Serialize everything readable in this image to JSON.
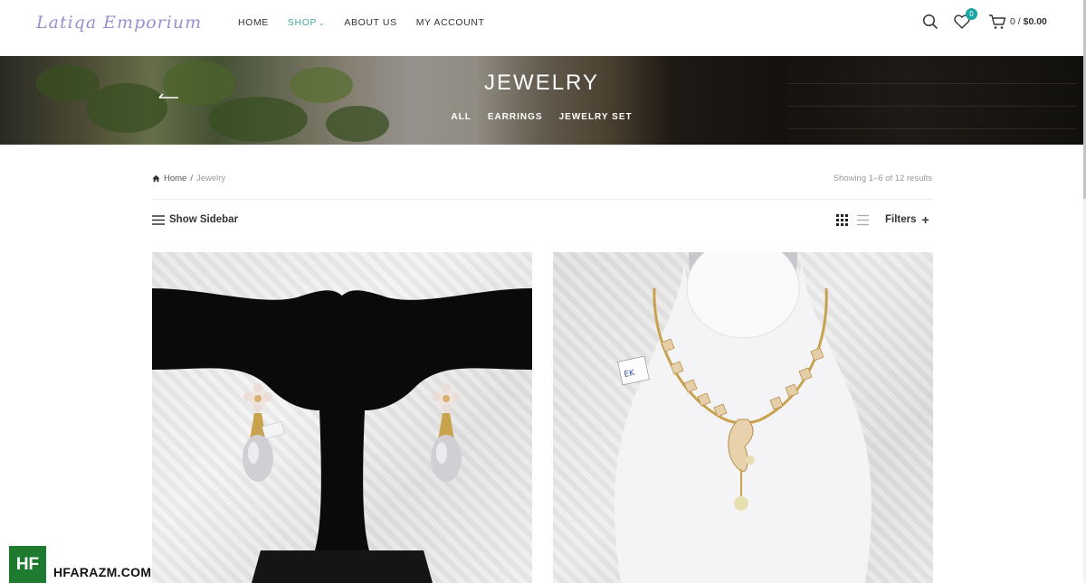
{
  "brand": {
    "logo_text": "Latiqa Emporium"
  },
  "nav": {
    "items": [
      {
        "label": "HOME",
        "active": false
      },
      {
        "label": "SHOP",
        "active": true,
        "has_dropdown": true
      },
      {
        "label": "ABOUT US",
        "active": false
      },
      {
        "label": "MY ACCOUNT",
        "active": false
      }
    ]
  },
  "header_icons": {
    "search": "search-icon",
    "wishlist": {
      "icon": "heart-icon",
      "count": "0"
    },
    "cart": {
      "icon": "cart-icon",
      "count": "0",
      "total": "$0.00",
      "separator": "/"
    }
  },
  "banner": {
    "title": "JEWELRY",
    "categories": [
      "ALL",
      "EARRINGS",
      "JEWELRY SET"
    ]
  },
  "breadcrumb": {
    "home": "Home",
    "separator": "/",
    "current": "Jewelry"
  },
  "results": "Showing 1–6 of 12 results",
  "toolbar": {
    "show_sidebar": "Show Sidebar",
    "filters": "Filters",
    "view_modes": [
      "grid-view-icon",
      "list-view-icon"
    ],
    "active_view": "grid"
  },
  "products": [
    {
      "image": "earrings-image",
      "description_icon": "earrings-on-stand"
    },
    {
      "image": "necklace-image",
      "description_icon": "necklace-on-bust"
    }
  ],
  "watermark": {
    "badge": "HF",
    "text": "HFARAZM.COM",
    "badge_color": "#1e7a2e"
  },
  "colors": {
    "accent": "#43a8a0",
    "badge": "#1aa6a0"
  }
}
